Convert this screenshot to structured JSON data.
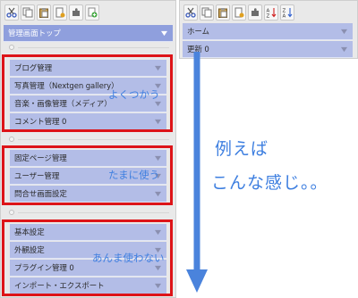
{
  "colors": {
    "menu_bg": "#b3bde7",
    "menu_header_bg": "#8f9fdd",
    "highlight_border": "#dd1418",
    "annotation_text": "#3e7fe0"
  },
  "left_panel": {
    "toolbar_icons": [
      "scissors-icon",
      "copy-icon",
      "paste-icon",
      "new-item-icon",
      "puzzle-icon",
      "plus-icon"
    ],
    "header_item": "管理画面トップ",
    "group_frequent": {
      "note": "よくつかう",
      "items": [
        "ブログ管理",
        "写真管理（Nextgen gallery）",
        "音楽・画像管理（メディア）",
        "コメント管理 0"
      ]
    },
    "group_sometimes": {
      "note": "たまに使う",
      "items": [
        "固定ページ管理",
        "ユーザー管理",
        "問合せ画面設定"
      ]
    },
    "group_rare": {
      "note": "あんま使わない",
      "items": [
        "基本設定",
        "外観設定",
        "プラグイン管理 0",
        "インポート・エクスポート"
      ]
    }
  },
  "right_panel": {
    "toolbar_icons": [
      "scissors-icon",
      "copy-icon",
      "paste-icon",
      "new-item-icon",
      "puzzle-icon",
      "sort-az-icon",
      "sort-za-icon"
    ],
    "items": [
      "ホーム",
      "更新 0"
    ]
  },
  "annotation": {
    "line1": "例えば",
    "line2": "こんな感じ。。"
  }
}
